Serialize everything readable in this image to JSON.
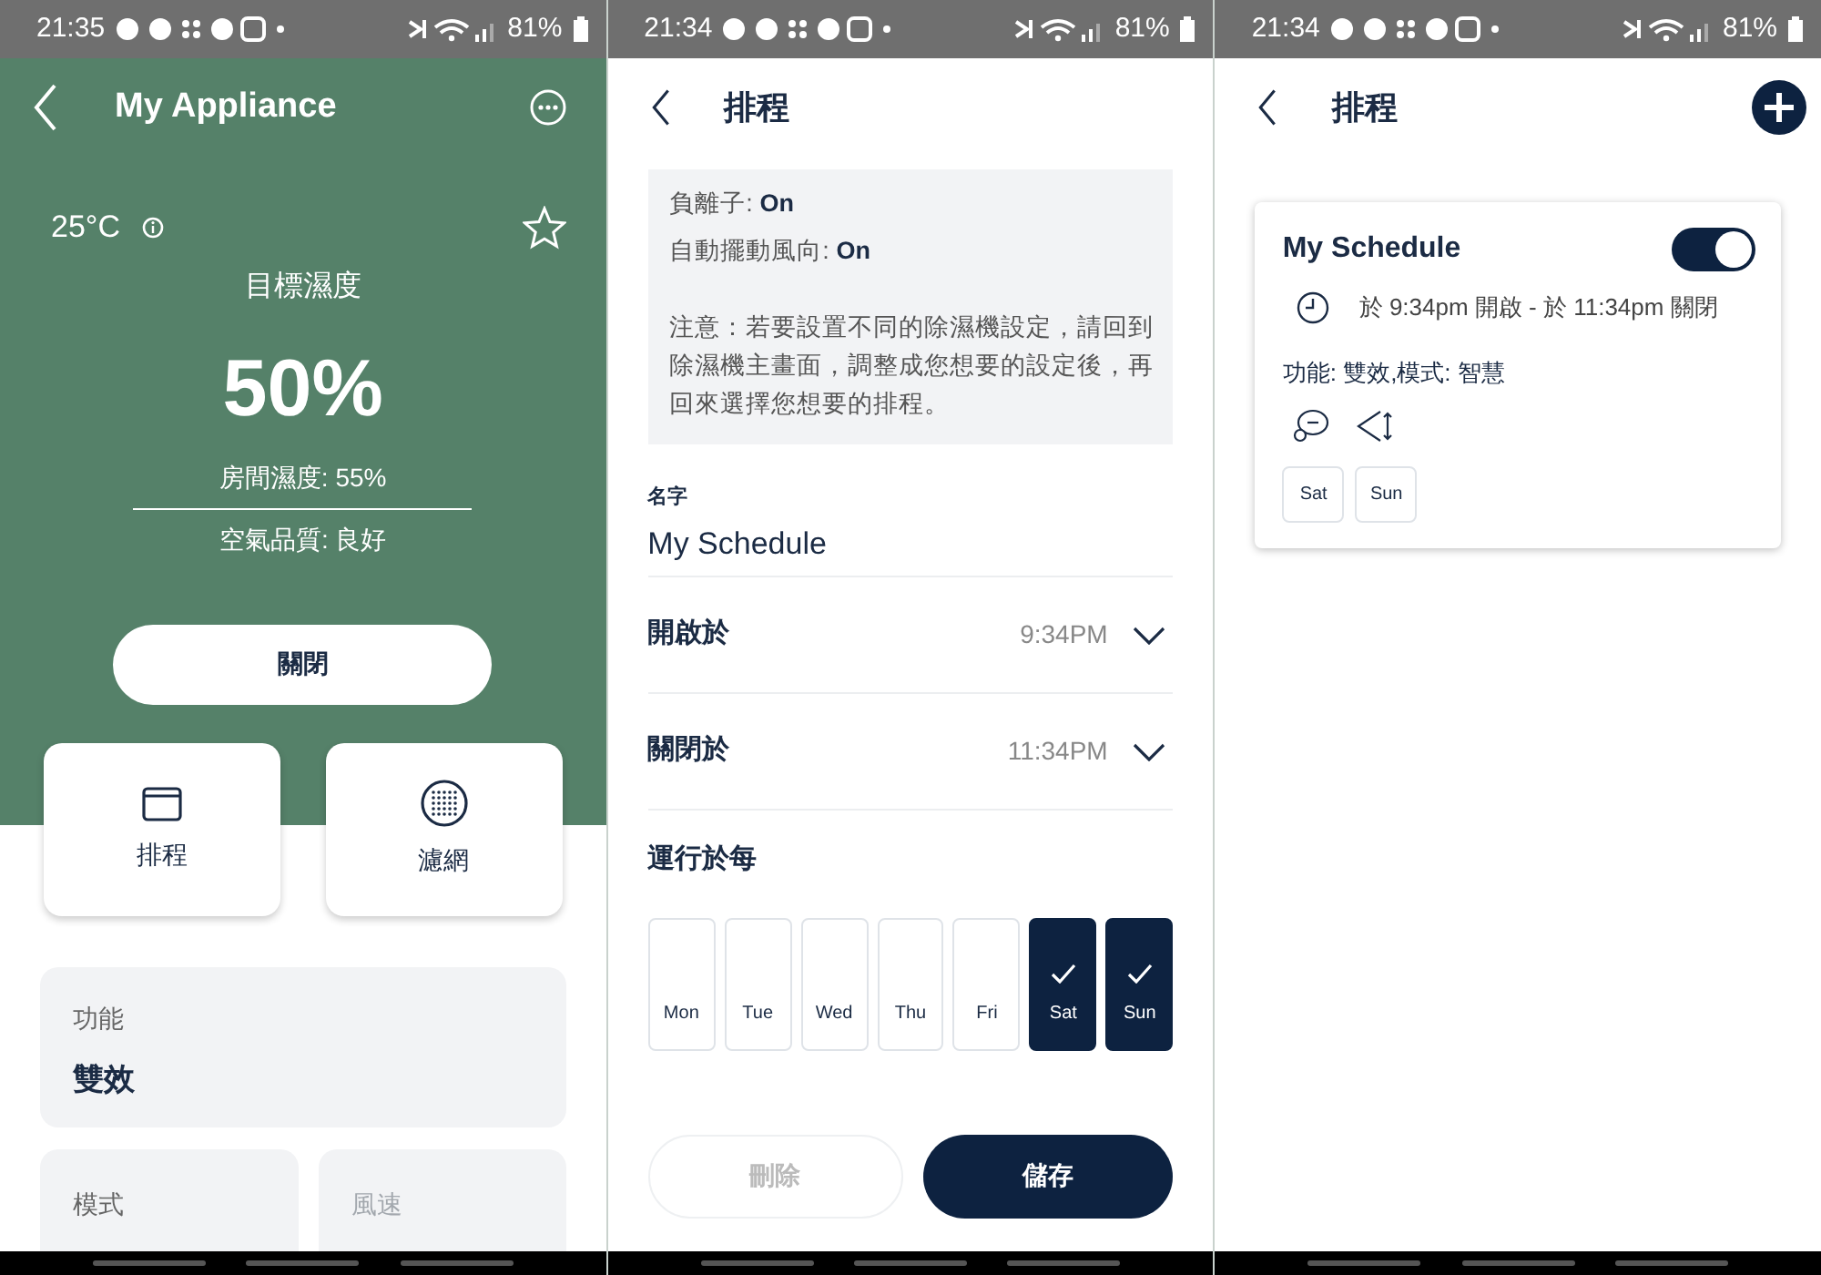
{
  "appliance_screen": {
    "status_bar": {
      "time": "21:35",
      "battery": "81%"
    },
    "title": "My Appliance",
    "temperature": "25°C",
    "favorite": false,
    "target_label": "目標濕度",
    "target_value": "50%",
    "room_humidity": "房間濕度: 55%",
    "air_quality": "空氣品質: 良好",
    "power_button": "關閉",
    "tiles": [
      {
        "kind": "calendar",
        "label": "排程"
      },
      {
        "kind": "filter",
        "label": "濾網"
      }
    ],
    "settings": [
      {
        "label": "功能",
        "value": "雙效",
        "disabled": false
      },
      {
        "label": "模式",
        "disabled": false
      },
      {
        "label": "風速",
        "disabled": true
      }
    ]
  },
  "schedule_edit_screen": {
    "status_bar": {
      "time": "21:34",
      "battery": "81%"
    },
    "title": "排程",
    "summary": [
      {
        "label": "負離子:",
        "value": "On"
      },
      {
        "label": "自動擺動風向:",
        "value": "On"
      }
    ],
    "note": "注意：若要設置不同的除濕機設定，請回到除濕機主畫面，調整成您想要的設定後，再回來選擇您想要的排程。",
    "name_label": "名字",
    "name_value": "My Schedule",
    "times": [
      {
        "label": "開啟於",
        "value": "9:34PM",
        "expanded": false
      },
      {
        "label": "關閉於",
        "value": "11:34PM",
        "expanded": false
      }
    ],
    "repeat_label": "運行於每",
    "days": [
      {
        "label": "Mon",
        "selected": false
      },
      {
        "label": "Tue",
        "selected": false
      },
      {
        "label": "Wed",
        "selected": false
      },
      {
        "label": "Thu",
        "selected": false
      },
      {
        "label": "Fri",
        "selected": false
      },
      {
        "label": "Sat",
        "selected": true
      },
      {
        "label": "Sun",
        "selected": true
      }
    ],
    "buttons": [
      {
        "label": "刪除",
        "kind": "secondary",
        "disabled": true
      },
      {
        "label": "儲存",
        "kind": "primary",
        "disabled": false
      }
    ]
  },
  "schedule_list_screen": {
    "status_bar": {
      "time": "21:34",
      "battery": "81%"
    },
    "title": "排程",
    "schedules": [
      {
        "name": "My Schedule",
        "enabled": true,
        "time_range": "於 9:34pm 開啟 - 於 11:34pm 關閉",
        "settings": "功能: 雙效,模式: 智慧",
        "days": [
          "Sat",
          "Sun"
        ]
      }
    ]
  }
}
